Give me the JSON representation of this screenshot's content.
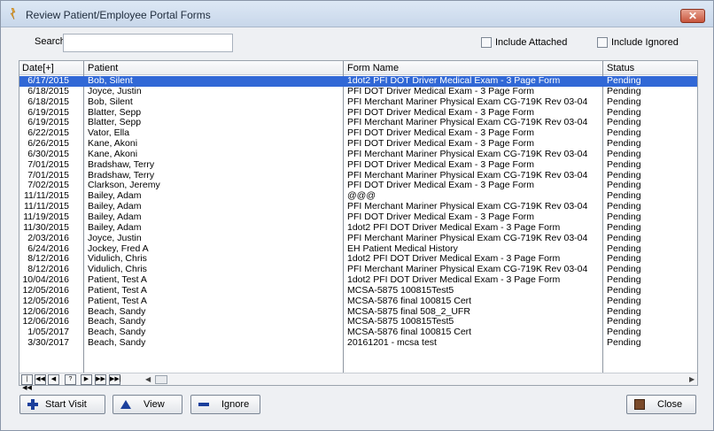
{
  "window": {
    "title": "Review Patient/Employee Portal Forms",
    "close_glyph": "✕"
  },
  "search": {
    "label": "Search:",
    "value": "",
    "placeholder": ""
  },
  "options": {
    "include_attached": {
      "label": "Include Attached",
      "checked": false
    },
    "include_ignored": {
      "label": "Include Ignored",
      "checked": false
    }
  },
  "grid": {
    "columns": {
      "date": "Date[+]",
      "patient": "Patient",
      "form": "Form Name",
      "status": "Status"
    },
    "rows": [
      {
        "date": "6/17/2015",
        "patient": "Bob, Silent",
        "form": "1dot2 PFI DOT Driver Medical Exam - 3 Page Form",
        "status": "Pending"
      },
      {
        "date": "6/18/2015",
        "patient": "Joyce, Justin",
        "form": "PFI DOT Driver Medical Exam - 3 Page Form",
        "status": "Pending"
      },
      {
        "date": "6/18/2015",
        "patient": "Bob, Silent",
        "form": "PFI Merchant Mariner Physical Exam CG-719K Rev 03-04",
        "status": "Pending"
      },
      {
        "date": "6/19/2015",
        "patient": "Blatter, Sepp",
        "form": "PFI DOT Driver Medical Exam - 3 Page Form",
        "status": "Pending"
      },
      {
        "date": "6/19/2015",
        "patient": "Blatter, Sepp",
        "form": "PFI Merchant Mariner Physical Exam CG-719K Rev 03-04",
        "status": "Pending"
      },
      {
        "date": "6/22/2015",
        "patient": "Vator, Ella",
        "form": "PFI DOT Driver Medical Exam - 3 Page Form",
        "status": "Pending"
      },
      {
        "date": "6/26/2015",
        "patient": "Kane, Akoni",
        "form": "PFI DOT Driver Medical Exam - 3 Page Form",
        "status": "Pending"
      },
      {
        "date": "6/30/2015",
        "patient": "Kane, Akoni",
        "form": "PFI Merchant Mariner Physical Exam CG-719K Rev 03-04",
        "status": "Pending"
      },
      {
        "date": "7/01/2015",
        "patient": "Bradshaw, Terry",
        "form": "PFI DOT Driver Medical Exam - 3 Page Form",
        "status": "Pending"
      },
      {
        "date": "7/01/2015",
        "patient": "Bradshaw, Terry",
        "form": "PFI Merchant Mariner Physical Exam CG-719K Rev 03-04",
        "status": "Pending"
      },
      {
        "date": "7/02/2015",
        "patient": "Clarkson, Jeremy",
        "form": "PFI DOT Driver Medical Exam - 3 Page Form",
        "status": "Pending"
      },
      {
        "date": "11/11/2015",
        "patient": "Bailey, Adam",
        "form": "@@@",
        "status": "Pending"
      },
      {
        "date": "11/11/2015",
        "patient": "Bailey, Adam",
        "form": "PFI Merchant Mariner Physical Exam CG-719K Rev 03-04",
        "status": "Pending"
      },
      {
        "date": "11/19/2015",
        "patient": "Bailey, Adam",
        "form": "PFI DOT Driver Medical Exam - 3 Page Form",
        "status": "Pending"
      },
      {
        "date": "11/30/2015",
        "patient": "Bailey, Adam",
        "form": "1dot2 PFI DOT Driver Medical Exam - 3 Page Form",
        "status": "Pending"
      },
      {
        "date": "2/03/2016",
        "patient": "Joyce, Justin",
        "form": "PFI Merchant Mariner Physical Exam CG-719K Rev 03-04",
        "status": "Pending"
      },
      {
        "date": "6/24/2016",
        "patient": "Jockey, Fred A",
        "form": "EH Patient Medical History",
        "status": "Pending"
      },
      {
        "date": "8/12/2016",
        "patient": "Vidulich, Chris",
        "form": "1dot2 PFI DOT Driver Medical Exam - 3 Page Form",
        "status": "Pending"
      },
      {
        "date": "8/12/2016",
        "patient": "Vidulich, Chris",
        "form": "PFI Merchant Mariner Physical Exam CG-719K Rev 03-04",
        "status": "Pending"
      },
      {
        "date": "10/04/2016",
        "patient": "Patient, Test A",
        "form": "1dot2 PFI DOT Driver Medical Exam - 3 Page Form",
        "status": "Pending"
      },
      {
        "date": "12/05/2016",
        "patient": "Patient, Test A",
        "form": "MCSA-5875 100815Test5",
        "status": "Pending"
      },
      {
        "date": "12/05/2016",
        "patient": "Patient, Test A",
        "form": "MCSA-5876 final 100815 Cert",
        "status": "Pending"
      },
      {
        "date": "12/06/2016",
        "patient": "Beach, Sandy",
        "form": "MCSA-5875 final 508_2_UFR",
        "status": "Pending"
      },
      {
        "date": "12/06/2016",
        "patient": "Beach, Sandy",
        "form": "MCSA-5875 100815Test5",
        "status": "Pending"
      },
      {
        "date": "1/05/2017",
        "patient": "Beach, Sandy",
        "form": "MCSA-5876 final 100815 Cert",
        "status": "Pending"
      },
      {
        "date": "3/30/2017",
        "patient": "Beach, Sandy",
        "form": "20161201 - mcsa test",
        "status": "Pending"
      }
    ],
    "selected_row_index": 0,
    "nav": {
      "first": "|◀◀",
      "prev_page": "◀◀",
      "prev": "◀",
      "help": "?",
      "next": "▶",
      "next_page": "▶▶",
      "last": "▶▶|"
    },
    "hscroll": {
      "left": "◀",
      "right": "▶"
    }
  },
  "buttons": {
    "start_visit": "Start Visit",
    "view": "View",
    "ignore": "Ignore",
    "close": "Close"
  },
  "colors": {
    "selection": "#3168d6",
    "button_icon": "#1b3f9c"
  }
}
